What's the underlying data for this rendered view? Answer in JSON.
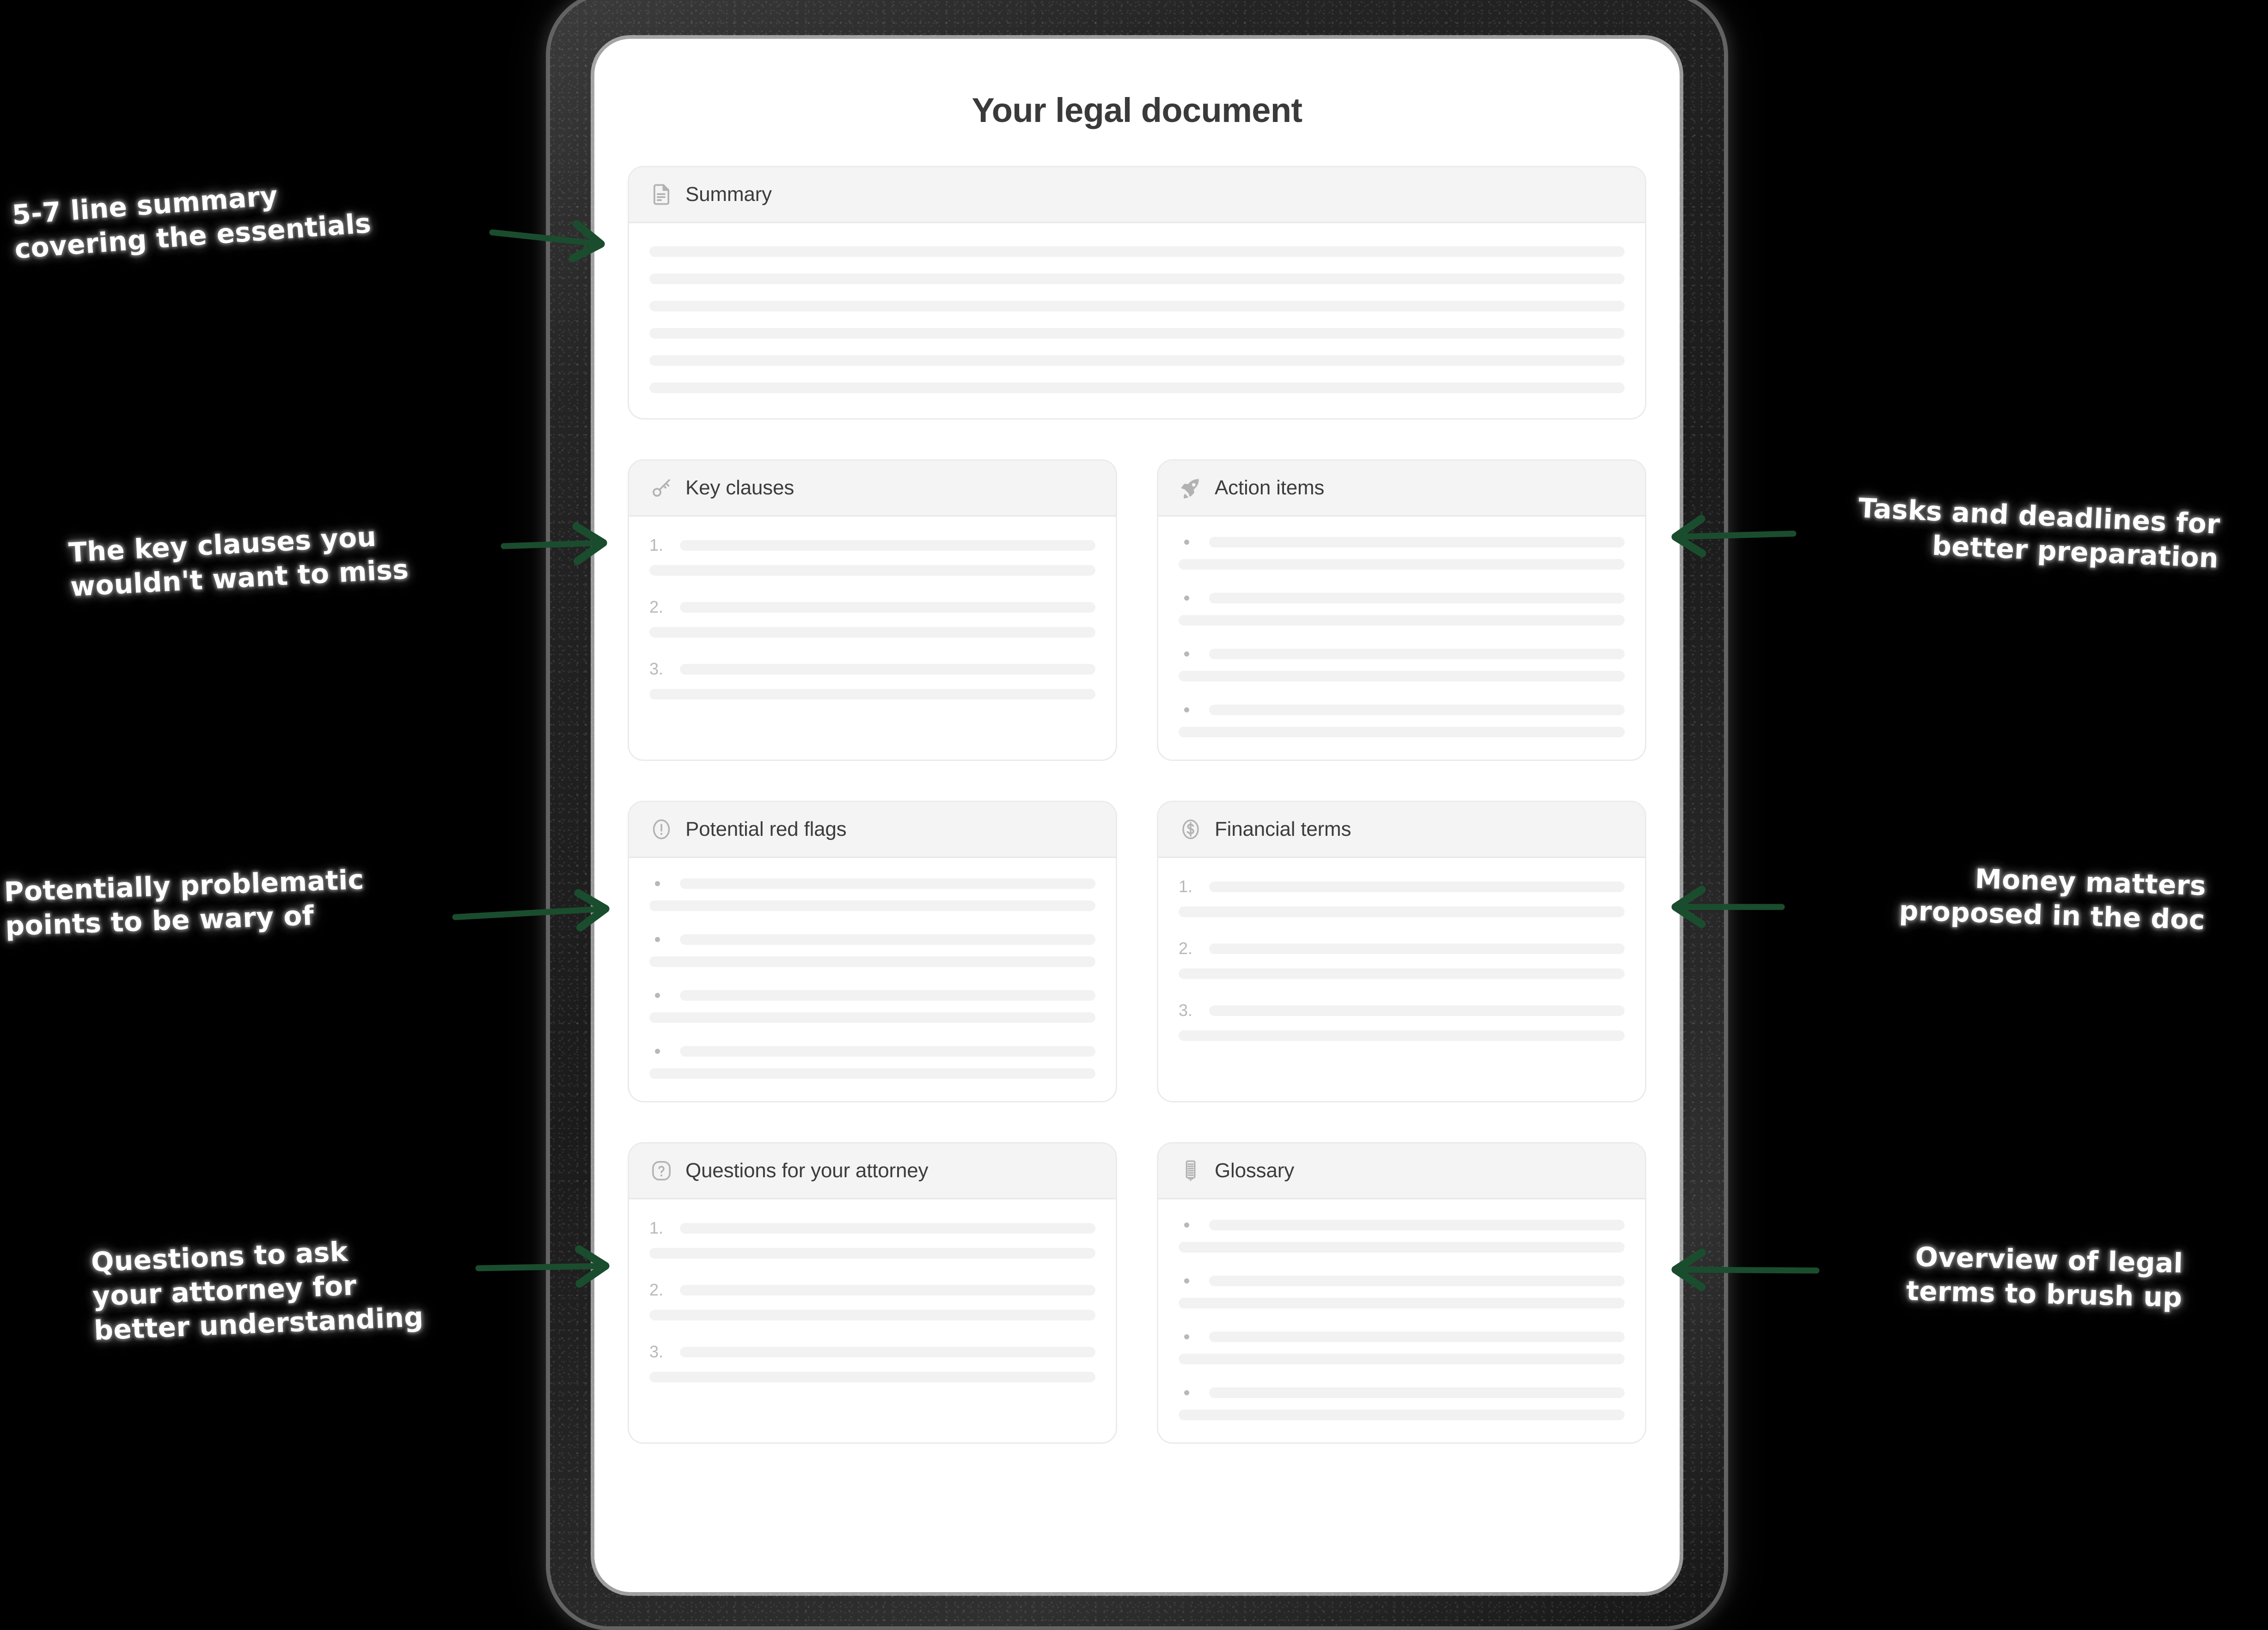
{
  "document": {
    "title": "Your legal document"
  },
  "cards": [
    {
      "id": "summary",
      "title": "Summary",
      "icon": "document-text-icon",
      "list_type": "lines",
      "item_count": 6
    },
    {
      "id": "key-clauses",
      "title": "Key clauses",
      "icon": "key-icon",
      "list_type": "numbered",
      "markers": [
        "1.",
        "2.",
        "3."
      ]
    },
    {
      "id": "action-items",
      "title": "Action items",
      "icon": "rocket-icon",
      "list_type": "bulleted",
      "item_count": 4
    },
    {
      "id": "potential-red-flags",
      "title": "Potential red flags",
      "icon": "alert-circle-icon",
      "list_type": "bulleted",
      "item_count": 4
    },
    {
      "id": "financial-terms",
      "title": "Financial terms",
      "icon": "dollar-circle-icon",
      "list_type": "numbered",
      "markers": [
        "1.",
        "2.",
        "3."
      ]
    },
    {
      "id": "questions-for-your-attorney",
      "title": "Questions for your attorney",
      "icon": "question-circle-icon",
      "list_type": "numbered",
      "markers": [
        "1.",
        "2.",
        "3."
      ]
    },
    {
      "id": "glossary",
      "title": "Glossary",
      "icon": "scroll-icon",
      "list_type": "bulleted",
      "item_count": 4
    }
  ],
  "annotations": {
    "summary": {
      "line1": "5-7 line summary",
      "line2": "covering the essentials"
    },
    "key_clauses": {
      "line1": "The key clauses you",
      "line2": "wouldn't want to miss"
    },
    "red_flags": {
      "line1": "Potentially problematic",
      "line2": "points to be wary of"
    },
    "questions": {
      "line1": "Questions to ask",
      "line2": "your attorney for",
      "line3": "better understanding"
    },
    "action_items": {
      "line1": "Tasks and deadlines for",
      "line2": "better preparation"
    },
    "financial_terms": {
      "line1": "Money matters",
      "line2": "proposed in the doc"
    },
    "glossary": {
      "line1": "Overview of legal",
      "line2": "terms to brush up"
    }
  },
  "colors": {
    "background": "#000000",
    "arrow": "#1a4d2e",
    "annotation_text": "#ffffff",
    "card_header_bg": "#f4f4f4",
    "card_border": "#ebebeb",
    "skeleton": "#f2f2f2",
    "title_text": "#3a3a3a",
    "card_title_text": "#3c3c3c",
    "icon": "#b2b2b2",
    "marker": "#b8b8b8",
    "device_bezel": "#242424",
    "screen": "#ffffff"
  }
}
